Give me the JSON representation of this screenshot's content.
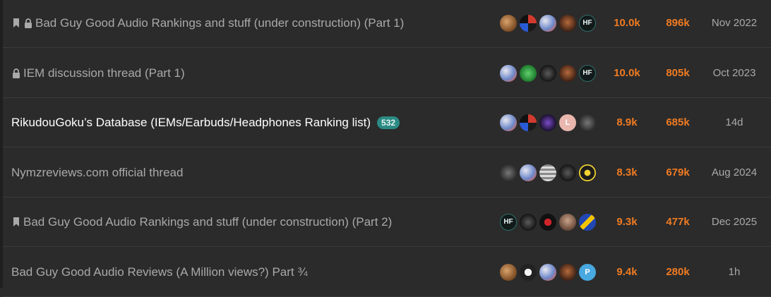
{
  "topics": [
    {
      "title": "Bad Guy Good Audio Rankings and stuff (under construction) (Part 1)",
      "bookmarked": true,
      "locked": true,
      "unread_count": null,
      "active": false,
      "posters": [
        "avatar-1",
        "avatar-2",
        "avatar-3",
        "avatar-4",
        "avatar-hf"
      ],
      "replies": "10.0k",
      "views": "896k",
      "activity": "Nov 2022"
    },
    {
      "title": "IEM discussion thread (Part 1)",
      "bookmarked": false,
      "locked": true,
      "unread_count": null,
      "active": false,
      "posters": [
        "avatar-3",
        "avatar-green",
        "avatar-5",
        "avatar-4",
        "avatar-hf"
      ],
      "replies": "10.0k",
      "views": "805k",
      "activity": "Oct 2023"
    },
    {
      "title": "RikudouGoku’s Database (IEMs/Earbuds/Headphones Ranking list)",
      "bookmarked": false,
      "locked": false,
      "unread_count": "532",
      "active": true,
      "posters": [
        "avatar-3",
        "avatar-2",
        "avatar-6",
        "avatar-l",
        "avatar-7"
      ],
      "poster_letters": {
        "avatar-l": "L"
      },
      "replies": "8.9k",
      "views": "685k",
      "activity": "14d"
    },
    {
      "title": "Nymzreviews.com official thread",
      "bookmarked": false,
      "locked": false,
      "unread_count": null,
      "active": false,
      "posters": [
        "avatar-7",
        "avatar-3",
        "avatar-8",
        "avatar-5",
        "avatar-9"
      ],
      "replies": "8.3k",
      "views": "679k",
      "activity": "Aug 2024"
    },
    {
      "title": "Bad Guy Good Audio Rankings and stuff (under construction) (Part 2)",
      "bookmarked": true,
      "locked": false,
      "unread_count": null,
      "active": false,
      "posters": [
        "avatar-hf",
        "avatar-5",
        "avatar-10",
        "avatar-11",
        "avatar-12"
      ],
      "replies": "9.3k",
      "views": "477k",
      "activity": "Dec 2025"
    },
    {
      "title": "Bad Guy Good Audio Reviews (A Million views?) Part ¾",
      "bookmarked": false,
      "locked": false,
      "unread_count": null,
      "active": false,
      "posters": [
        "avatar-1",
        "avatar-13",
        "avatar-3",
        "avatar-4",
        "avatar-p"
      ],
      "poster_letters": {
        "avatar-p": "P"
      },
      "replies": "9.4k",
      "views": "280k",
      "activity": "1h"
    }
  ],
  "icons": {
    "bookmark": "bookmark-icon",
    "lock": "lock-icon"
  },
  "colors": {
    "background": "#2b2b2b",
    "row_divider": "#3a3a3a",
    "title_read": "#a9a9a9",
    "title_active": "#ffffff",
    "stat_hot": "#f07b22",
    "badge": "#2a8b84"
  },
  "hf_label": "HF"
}
